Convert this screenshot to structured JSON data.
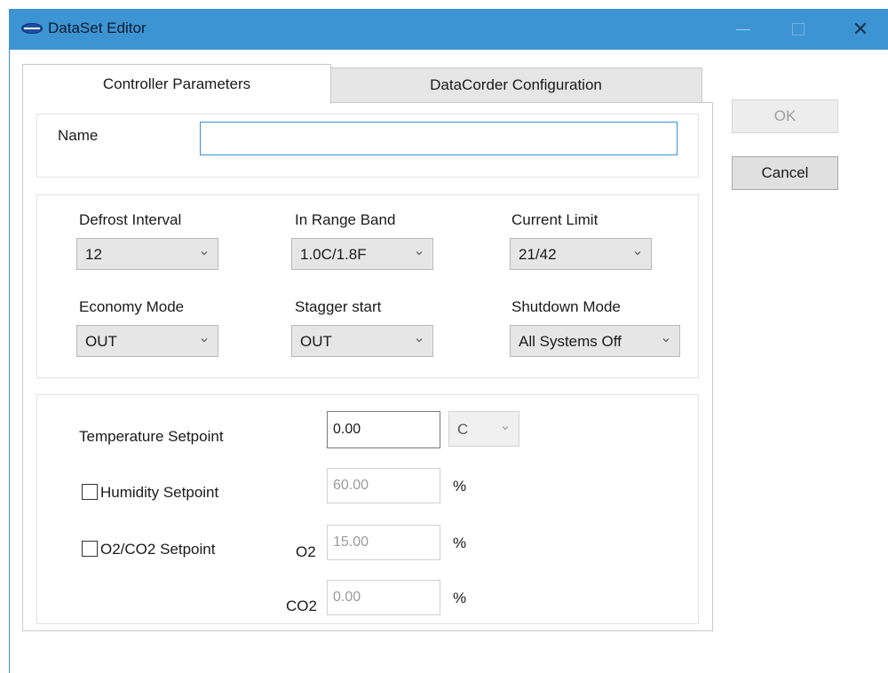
{
  "window": {
    "title": "DataSet Editor",
    "close_glyph": "✕",
    "accent_color": "#3c94d3"
  },
  "tabs": [
    {
      "label": "Controller Parameters",
      "selected": true
    },
    {
      "label": "DataCorder Configuration",
      "selected": false
    }
  ],
  "name_section": {
    "label": "Name",
    "value": ""
  },
  "parameters": {
    "defrost_interval": {
      "label": "Defrost Interval",
      "value": "12"
    },
    "in_range_band": {
      "label": "In Range Band",
      "value": "1.0C/1.8F"
    },
    "current_limit": {
      "label": "Current Limit",
      "value": "21/42"
    },
    "economy_mode": {
      "label": "Economy Mode",
      "value": "OUT"
    },
    "stagger_start": {
      "label": "Stagger start",
      "value": "OUT"
    },
    "shutdown_mode": {
      "label": "Shutdown Mode",
      "value": "All Systems Off"
    }
  },
  "setpoints": {
    "temperature": {
      "label": "Temperature Setpoint",
      "value": "0.00",
      "unit": "C"
    },
    "humidity": {
      "label": "Humidity Setpoint",
      "checked": false,
      "value": "60.00",
      "unit": "%"
    },
    "o2co2": {
      "label": "O2/CO2 Setpoint",
      "checked": false,
      "o2_label": "O2",
      "o2_value": "15.00",
      "o2_unit": "%",
      "co2_label": "CO2",
      "co2_value": "0.00",
      "co2_unit": "%"
    }
  },
  "buttons": {
    "ok": {
      "label": "OK",
      "enabled": false
    },
    "cancel": {
      "label": "Cancel",
      "enabled": true
    }
  }
}
